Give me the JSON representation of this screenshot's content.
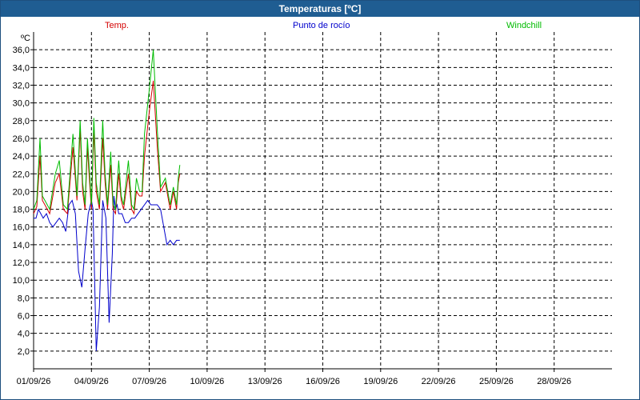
{
  "window": {
    "title": "Temperaturas [ºC]"
  },
  "colors": {
    "titlebar": "#1f5d92",
    "temp": "#d40000",
    "dew": "#0000cc",
    "windchill": "#00bb00",
    "grid": "#000000"
  },
  "chart_data": {
    "type": "line",
    "title": "Temperaturas [ºC]",
    "y_unit": "ºC",
    "ylim": [
      0,
      38
    ],
    "yticks": [
      2,
      4,
      6,
      8,
      10,
      12,
      14,
      16,
      18,
      20,
      22,
      24,
      26,
      28,
      30,
      32,
      34,
      36
    ],
    "ytick_labels": [
      "2,0",
      "4,0",
      "6,0",
      "8,0",
      "10,0",
      "12,0",
      "14,0",
      "16,0",
      "18,0",
      "20,0",
      "22,0",
      "24,0",
      "26,0",
      "28,0",
      "30,0",
      "32,0",
      "34,0",
      "36,0"
    ],
    "x_start": "01/09/26",
    "x_end": "01/10/26",
    "xtick_labels": [
      "01/09/26",
      "04/09/26",
      "07/09/26",
      "10/09/26",
      "13/09/26",
      "16/09/26",
      "19/09/26",
      "22/09/26",
      "25/09/26",
      "28/09/26"
    ],
    "grid": true,
    "legend": [
      "Temp.",
      "Punto de rocío",
      "Windchill"
    ],
    "series": [
      {
        "name": "Temp.",
        "color": "#d40000",
        "x": [
          "01/09/26 00:00",
          "01/09/26 04:00",
          "01/09/26 08:00",
          "01/09/26 11:00",
          "01/09/26 14:00",
          "01/09/26 20:00",
          "02/09/26 03:00",
          "02/09/26 08:00",
          "02/09/26 13:00",
          "02/09/26 18:00",
          "03/09/26 01:00",
          "03/09/26 06:00",
          "03/09/26 10:00",
          "03/09/26 13:00",
          "03/09/26 16:00",
          "03/09/26 19:00",
          "03/09/26 21:00",
          "04/09/26 00:00",
          "04/09/26 03:00",
          "04/09/26 06:00",
          "04/09/26 10:00",
          "04/09/26 14:00",
          "04/09/26 17:00",
          "04/09/26 20:00",
          "05/09/26 00:00",
          "05/09/26 03:00",
          "05/09/26 06:00",
          "05/09/26 10:00",
          "05/09/26 13:00",
          "05/09/26 16:00",
          "05/09/26 19:00",
          "05/09/26 22:00",
          "06/09/26 02:00",
          "06/09/26 05:00",
          "06/09/26 08:00",
          "06/09/26 12:00",
          "06/09/26 15:00",
          "06/09/26 18:00",
          "07/09/26 00:00",
          "07/09/26 05:00",
          "07/09/26 10:00",
          "07/09/26 14:00",
          "07/09/26 20:00",
          "08/09/26 02:00",
          "08/09/26 06:00",
          "08/09/26 10:00",
          "08/09/26 12:00",
          "08/09/26 14:00"
        ],
        "values": [
          17.5,
          18.3,
          24.0,
          19.0,
          18.5,
          17.5,
          21.0,
          22.0,
          18.0,
          17.5,
          25.0,
          19.0,
          27.0,
          20.0,
          18.0,
          25.0,
          22.0,
          18.0,
          27.0,
          20.0,
          18.0,
          26.0,
          21.0,
          18.0,
          23.0,
          18.0,
          17.5,
          22.0,
          19.0,
          18.0,
          20.0,
          22.0,
          18.0,
          17.5,
          20.0,
          19.5,
          19.5,
          24.0,
          29.0,
          32.5,
          25.0,
          20.0,
          21.0,
          18.0,
          20.0,
          18.0,
          21.0,
          22.0
        ],
        "note": ""
      },
      {
        "name": "Punto de rocío",
        "color": "#0000cc",
        "x": [
          "01/09/26 00:00",
          "01/09/26 03:00",
          "01/09/26 06:00",
          "01/09/26 09:00",
          "01/09/26 12:00",
          "01/09/26 16:00",
          "01/09/26 20:00",
          "02/09/26 00:00",
          "02/09/26 04:00",
          "02/09/26 08:00",
          "02/09/26 12:00",
          "02/09/26 16:00",
          "02/09/26 20:00",
          "03/09/26 00:00",
          "03/09/26 04:00",
          "03/09/26 08:00",
          "03/09/26 12:00",
          "03/09/26 16:00",
          "03/09/26 20:00",
          "04/09/26 00:00",
          "04/09/26 02:00",
          "04/09/26 06:00",
          "04/09/26 10:00",
          "04/09/26 14:00",
          "04/09/26 18:00",
          "04/09/26 22:00",
          "05/09/26 02:00",
          "05/09/26 04:00",
          "05/09/26 06:00",
          "05/09/26 08:00",
          "05/09/26 10:00",
          "05/09/26 14:00",
          "05/09/26 18:00",
          "05/09/26 22:00",
          "06/09/26 02:00",
          "06/09/26 06:00",
          "06/09/26 10:00",
          "06/09/26 14:00",
          "06/09/26 18:00",
          "06/09/26 22:00",
          "07/09/26 02:00",
          "07/09/26 06:00",
          "07/09/26 10:00",
          "07/09/26 14:00",
          "07/09/26 18:00",
          "07/09/26 22:00",
          "08/09/26 02:00",
          "08/09/26 06:00",
          "08/09/26 10:00",
          "08/09/26 14:00"
        ],
        "values": [
          17.0,
          17.0,
          18.0,
          17.5,
          17.0,
          17.5,
          16.5,
          16.0,
          16.5,
          17.0,
          16.5,
          15.5,
          18.5,
          19.0,
          17.5,
          11.0,
          9.2,
          13.5,
          17.5,
          19.0,
          18.0,
          2.0,
          7.0,
          19.0,
          17.0,
          5.2,
          13.0,
          19.5,
          18.0,
          18.5,
          17.5,
          17.5,
          16.5,
          16.5,
          17.0,
          17.0,
          17.5,
          18.0,
          18.5,
          19.0,
          18.5,
          18.5,
          18.5,
          18.0,
          16.0,
          14.0,
          14.5,
          14.0,
          14.5,
          14.5
        ],
        "note": ""
      },
      {
        "name": "Windchill",
        "color": "#00bb00",
        "x": [
          "01/09/26 00:00",
          "01/09/26 04:00",
          "01/09/26 08:00",
          "01/09/26 11:00",
          "01/09/26 14:00",
          "01/09/26 20:00",
          "02/09/26 03:00",
          "02/09/26 08:00",
          "02/09/26 13:00",
          "02/09/26 18:00",
          "03/09/26 01:00",
          "03/09/26 06:00",
          "03/09/26 10:00",
          "03/09/26 13:00",
          "03/09/26 16:00",
          "03/09/26 19:00",
          "03/09/26 21:00",
          "04/09/26 00:00",
          "04/09/26 03:00",
          "04/09/26 06:00",
          "04/09/26 10:00",
          "04/09/26 14:00",
          "04/09/26 17:00",
          "04/09/26 20:00",
          "05/09/26 00:00",
          "05/09/26 03:00",
          "05/09/26 06:00",
          "05/09/26 10:00",
          "05/09/26 13:00",
          "05/09/26 16:00",
          "05/09/26 19:00",
          "05/09/26 22:00",
          "06/09/26 02:00",
          "06/09/26 05:00",
          "06/09/26 08:00",
          "06/09/26 12:00",
          "06/09/26 15:00",
          "06/09/26 18:00",
          "07/09/26 00:00",
          "07/09/26 05:00",
          "07/09/26 10:00",
          "07/09/26 14:00",
          "07/09/26 20:00",
          "08/09/26 02:00",
          "08/09/26 06:00",
          "08/09/26 10:00",
          "08/09/26 12:00",
          "08/09/26 14:00"
        ],
        "values": [
          18.0,
          19.0,
          26.0,
          19.5,
          19.0,
          18.0,
          22.0,
          23.5,
          18.5,
          18.0,
          26.5,
          19.5,
          28.0,
          21.0,
          18.5,
          26.0,
          23.0,
          18.5,
          28.3,
          21.0,
          18.5,
          28.0,
          22.0,
          18.5,
          24.5,
          18.5,
          18.0,
          23.5,
          19.5,
          18.5,
          21.0,
          23.5,
          18.5,
          18.0,
          21.5,
          20.0,
          20.0,
          26.5,
          31.5,
          36.0,
          27.0,
          20.5,
          21.5,
          18.5,
          20.5,
          18.5,
          21.5,
          23.0
        ],
        "note": ""
      }
    ]
  }
}
